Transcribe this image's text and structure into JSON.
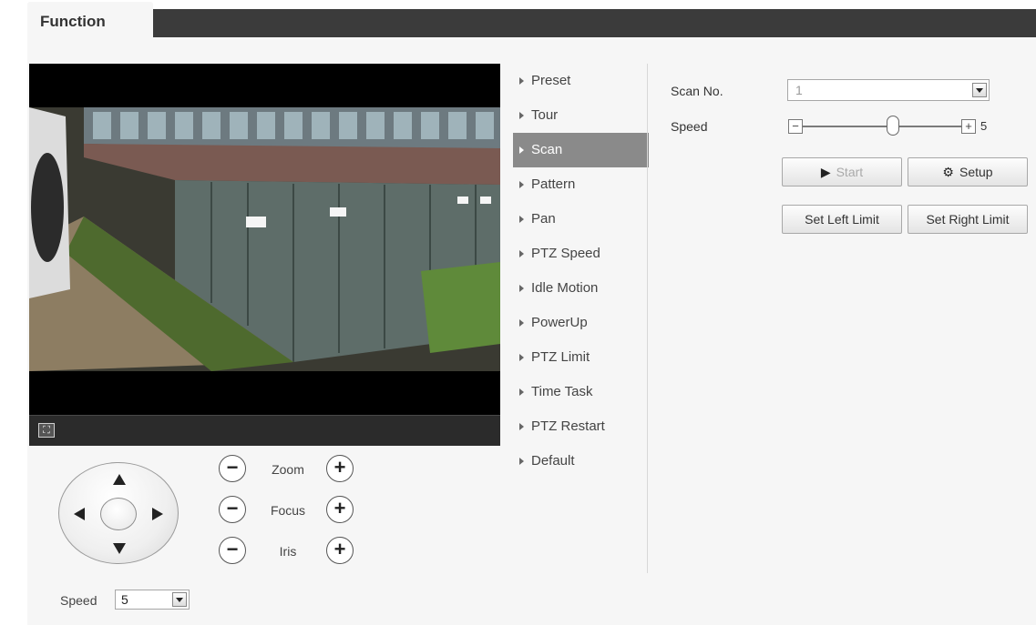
{
  "header": {
    "tab_label": "Function"
  },
  "ptz": {
    "zoom_label": "Zoom",
    "focus_label": "Focus",
    "iris_label": "Iris",
    "minus_glyph": "−",
    "plus_glyph": "+",
    "speed_label": "Speed",
    "speed_value": "5"
  },
  "menu": {
    "items": [
      {
        "label": "Preset"
      },
      {
        "label": "Tour"
      },
      {
        "label": "Scan"
      },
      {
        "label": "Pattern"
      },
      {
        "label": "Pan"
      },
      {
        "label": "PTZ Speed"
      },
      {
        "label": "Idle Motion"
      },
      {
        "label": "PowerUp"
      },
      {
        "label": "PTZ Limit"
      },
      {
        "label": "Time Task"
      },
      {
        "label": "PTZ Restart"
      },
      {
        "label": "Default"
      }
    ],
    "active": "Scan"
  },
  "scan": {
    "scan_no_label": "Scan No.",
    "scan_no_value": "1",
    "speed_label": "Speed",
    "speed_value": "5",
    "slider_level": 5,
    "slider_max": 8,
    "start_label": "Start",
    "setup_label": "Setup",
    "left_limit_label": "Set Left Limit",
    "right_limit_label": "Set Right Limit"
  },
  "icons": {
    "fullscreen": "fullscreen-icon",
    "play": "play-icon",
    "gear": "gear-icon"
  }
}
